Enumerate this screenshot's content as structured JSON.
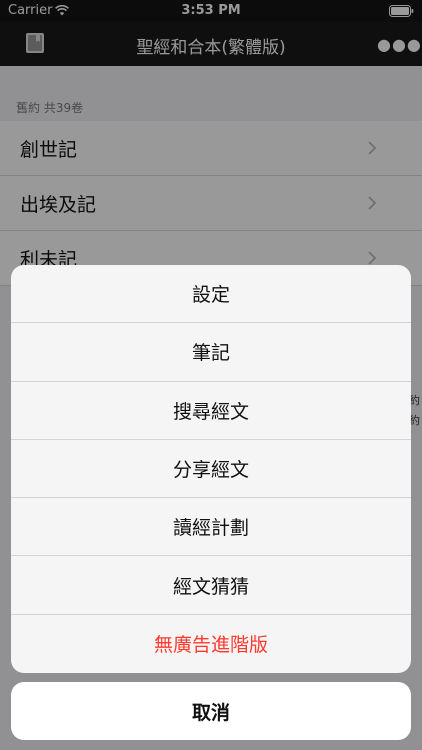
{
  "status_bar": {
    "carrier": "Carrier",
    "time": "3:53 PM"
  },
  "nav": {
    "title": "聖經和合本(繁體版)"
  },
  "section": {
    "header": "舊約 共39卷"
  },
  "books": [
    {
      "name": "創世記"
    },
    {
      "name": "出埃及記"
    },
    {
      "name": "利未記"
    }
  ],
  "side_text": [
    "約",
    "約"
  ],
  "action_sheet": {
    "items": [
      {
        "label": "設定"
      },
      {
        "label": "筆記"
      },
      {
        "label": "搜尋經文"
      },
      {
        "label": "分享經文"
      },
      {
        "label": "讀經計劃"
      },
      {
        "label": "經文猜猜"
      },
      {
        "label": "無廣告進階版"
      }
    ],
    "cancel_label": "取消"
  },
  "colors": {
    "destructive": "#ff3b30",
    "nav_bg": "#1a1a1a"
  }
}
